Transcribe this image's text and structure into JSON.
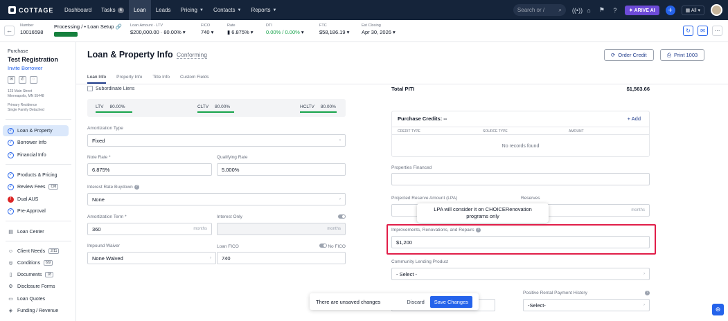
{
  "app": {
    "logo_text": "COTTAGE"
  },
  "nav": [
    {
      "label": "Dashboard"
    },
    {
      "label": "Tasks",
      "badge": "6"
    },
    {
      "label": "Loan"
    },
    {
      "label": "Leads"
    },
    {
      "label": "Pricing"
    },
    {
      "label": "Contacts"
    },
    {
      "label": "Reports"
    }
  ],
  "topbar": {
    "search_placeholder": "Search or /",
    "arive_label": "ARIVE AI",
    "filter_label": "All"
  },
  "loanbar": {
    "loan_no_label": "Number",
    "loan_no": "10016598",
    "processing_label": "Processing",
    "loan_setup_label": "Loan Setup",
    "progress_fraction": 1.0,
    "amount_label": "Loan Amount · LTV",
    "amount_value": "$200,000.00 · 80.00%",
    "fico_label": "FICO",
    "fico_value": "740",
    "rate_label": "Rate",
    "rate_value": "6.875%",
    "dti_label": "DTI",
    "dti_value": "0.00% / 0.00%",
    "ftc_label": "FTC",
    "ftc_value": "$58,186.19",
    "closing_label": "Est Closing",
    "closing_value": "Apr 30, 2026"
  },
  "sidebar": {
    "loan_type": "Purchase",
    "borrower_name": "Test Registration",
    "invite_label": "Invite Borrower",
    "address_line1": "123 Main Street",
    "address_line2": "Minneapolis, MN 55448",
    "property_line1": "Primary Residence",
    "property_line2": "Single Family Detached",
    "items": [
      {
        "label": "Loan & Property"
      },
      {
        "label": "Borrower Info"
      },
      {
        "label": "Financial Info"
      },
      {
        "label": "Products & Pricing"
      },
      {
        "label": "Review Fees",
        "tag": "CM"
      },
      {
        "label": "Dual AUS"
      },
      {
        "label": "Pre-Approval"
      },
      {
        "label": "Loan Center"
      },
      {
        "label": "Client Needs",
        "tag": "2/11"
      },
      {
        "label": "Conditions",
        "tag": "6/9"
      },
      {
        "label": "Documents",
        "tag": "18"
      },
      {
        "label": "Disclosure Forms"
      },
      {
        "label": "Loan Quotes"
      },
      {
        "label": "Funding / Revenue"
      }
    ]
  },
  "page": {
    "title": "Loan & Property Info",
    "subtitle": "Conforming",
    "order_credit_label": "Order Credit",
    "print_label": "Print 1003",
    "tabs": [
      "Loan Info",
      "Property Info",
      "Title Info",
      "Custom Fields"
    ]
  },
  "left": {
    "subordinate_label": "Subordinate Liens",
    "ltv_label": "LTV",
    "ltv_value": "80.00%",
    "cltv_label": "CLTV",
    "cltv_value": "80.00%",
    "hcltv_label": "HCLTV",
    "hcltv_value": "80.00%",
    "amort_type_label": "Amortization Type",
    "amort_type_value": "Fixed",
    "note_rate_label": "Note Rate *",
    "note_rate_value": "6.875%",
    "qual_rate_label": "Qualifying Rate",
    "qual_rate_value": "5.000%",
    "buydown_label": "Interest Rate Buydown",
    "buydown_value": "None",
    "amort_term_label": "Amortization Term *",
    "amort_term_value": "360",
    "amort_term_unit": "months",
    "interest_only_label": "Interest Only",
    "interest_only_unit": "months",
    "impound_label": "Impound Waiver",
    "impound_value": "None Waived",
    "loan_fico_label": "Loan FICO",
    "no_fico_label": "No FICO",
    "loan_fico_value": "740"
  },
  "right": {
    "total_piti_label": "Total PITI",
    "total_piti_value": "$1,563.66",
    "purchase_credits_label": "Purchase Credits: --",
    "add_label": "+ Add",
    "table_headers": [
      "CREDIT TYPE",
      "SOURCE TYPE",
      "AMOUNT"
    ],
    "no_records": "No records found",
    "properties_financed_label": "Properties Financed",
    "reserve_label": "Projected Reserve Amount (LPA)",
    "reserves_label": "Reserves",
    "reserves_unit": "months",
    "tooltip_line1": "LPA will consider it on CHOICERenovation",
    "tooltip_line2": "programs only",
    "improvements_label": "Improvements, Renovations, and Repairs",
    "improvements_value": "$1,200",
    "community_label": "Community Lending Product",
    "community_value": "- Select -",
    "rental_label": "Positive Rental Payment History",
    "rental_value": "-Select-"
  },
  "savebar": {
    "message": "There are unsaved changes",
    "discard_label": "Discard",
    "save_label": "Save Changes"
  }
}
